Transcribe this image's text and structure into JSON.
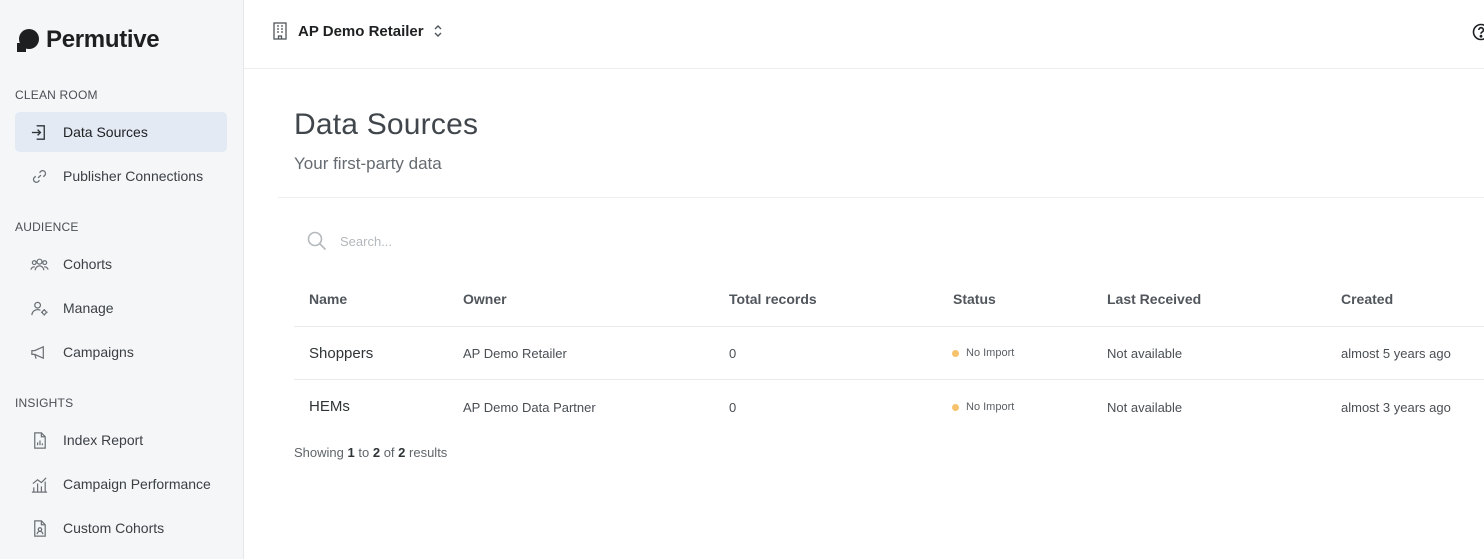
{
  "brand": {
    "name": "Permutive"
  },
  "sidebar": {
    "sections": [
      {
        "label": "CLEAN ROOM",
        "items": [
          {
            "label": "Data Sources",
            "icon": "import-icon",
            "active": true
          },
          {
            "label": "Publisher Connections",
            "icon": "link-icon"
          }
        ]
      },
      {
        "label": "AUDIENCE",
        "items": [
          {
            "label": "Cohorts",
            "icon": "users-icon"
          },
          {
            "label": "Manage",
            "icon": "user-settings-icon"
          },
          {
            "label": "Campaigns",
            "icon": "megaphone-icon"
          }
        ]
      },
      {
        "label": "INSIGHTS",
        "items": [
          {
            "label": "Index Report",
            "icon": "report-icon"
          },
          {
            "label": "Campaign Performance",
            "icon": "chart-icon"
          },
          {
            "label": "Custom Cohorts",
            "icon": "custom-report-icon"
          }
        ]
      }
    ]
  },
  "topbar": {
    "org_name": "AP Demo Retailer"
  },
  "main": {
    "title": "Data Sources",
    "subtitle": "Your first-party data",
    "search_placeholder": "Search...",
    "columns": [
      "Name",
      "Owner",
      "Total records",
      "Status",
      "Last Received",
      "Created"
    ],
    "rows": [
      {
        "name": "Shoppers",
        "owner": "AP Demo Retailer",
        "records": "0",
        "status": "No Import",
        "last_received": "Not available",
        "created": "almost 5 years ago"
      },
      {
        "name": "HEMs",
        "owner": "AP Demo Data Partner",
        "records": "0",
        "status": "No Import",
        "last_received": "Not available",
        "created": "almost 3 years ago"
      }
    ],
    "footer": {
      "prefix": "Showing",
      "from": "1",
      "to_word": "to",
      "to": "2",
      "of_word": "of",
      "total": "2",
      "suffix": "results"
    }
  },
  "colors": {
    "status_pending": "#f6c26b",
    "active_nav_bg": "#e3eaf3"
  }
}
